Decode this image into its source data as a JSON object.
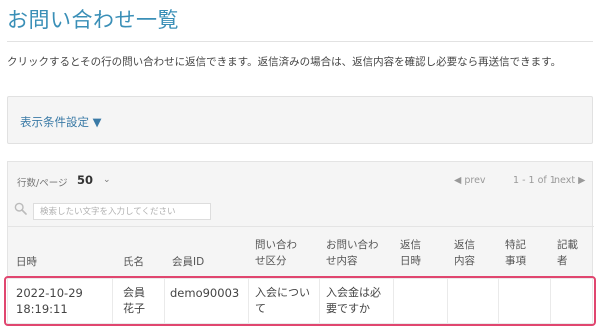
{
  "page": {
    "title": "お問い合わせ一覧",
    "description": "クリックするとその行の問い合わせに返信できます。返信済みの場合は、返信内容を確認し必要なら再送信できます。"
  },
  "filter": {
    "label": "表示条件設定 ▼"
  },
  "pager": {
    "rows_label": "行数/ページ",
    "rows_value": "50",
    "prev_label": "prev",
    "info": "1 - 1 of 1",
    "next_label": "next"
  },
  "search": {
    "placeholder": "検索したい文字を入力してください"
  },
  "table": {
    "headers": [
      "日時",
      "氏名",
      "会員ID",
      "問い合わ\nせ区分",
      "お問い合わ\nせ内容",
      "返信\n日時",
      "返信\n内容",
      "特記\n事項",
      "記載\n者"
    ],
    "rows": [
      {
        "datetime": "2022-10-29\n18:19:11",
        "name": "会員\n花子",
        "member_id": "demo90003",
        "category": "入会につい\nて",
        "content": "入会金は必\n要ですか",
        "reply_datetime": "",
        "reply_content": "",
        "notes": "",
        "author": ""
      }
    ]
  },
  "colors": {
    "accent": "#3a8fb7",
    "highlight": "#e0466f"
  }
}
